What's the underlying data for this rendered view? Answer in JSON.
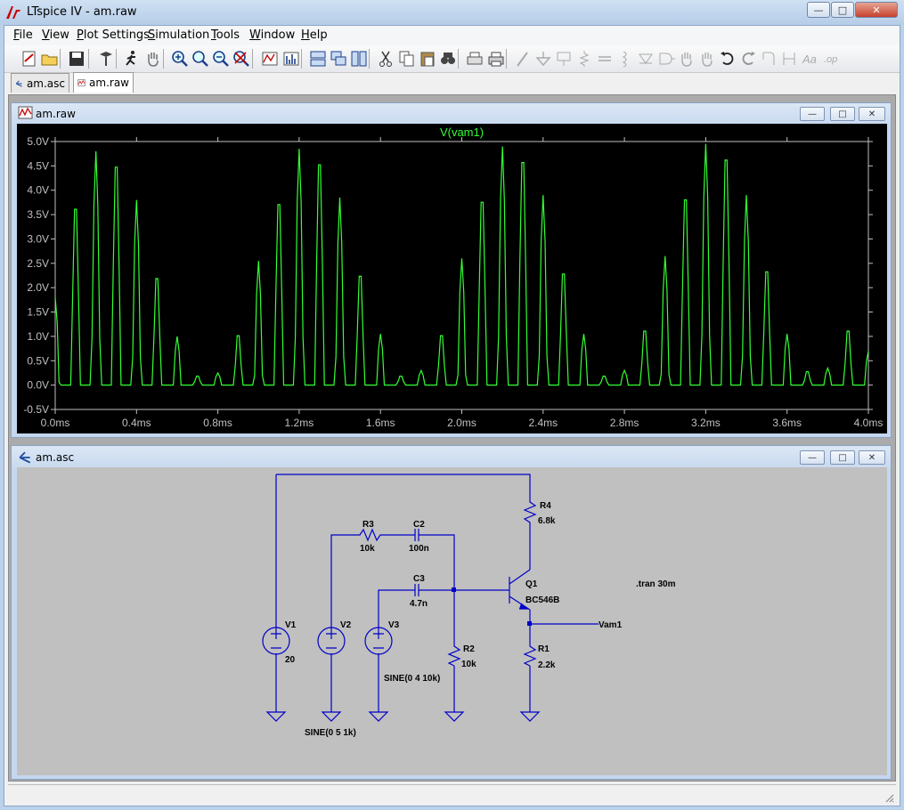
{
  "app": {
    "title": "LTspice IV - am.raw"
  },
  "window_controls": {
    "minimize": "—",
    "maximize": "□",
    "close": "✕"
  },
  "menu": {
    "items": [
      {
        "label": "File",
        "mnemonic": "F",
        "rest": "ile"
      },
      {
        "label": "View",
        "mnemonic": "V",
        "rest": "iew"
      },
      {
        "label": "Plot Settings",
        "mnemonic": "P",
        "rest": "lot Settings"
      },
      {
        "label": "Simulation",
        "mnemonic": "S",
        "rest": "imulation"
      },
      {
        "label": "Tools",
        "mnemonic": "T",
        "rest": "ools"
      },
      {
        "label": "Window",
        "mnemonic": "W",
        "rest": "indow"
      },
      {
        "label": "Help",
        "mnemonic": "H",
        "rest": "elp"
      }
    ]
  },
  "toolbar": {
    "buttons": [
      {
        "name": "new-schematic-icon",
        "enabled": true
      },
      {
        "name": "open-icon",
        "enabled": true
      },
      {
        "name": "save-icon",
        "enabled": true
      },
      {
        "name": "control-panel-icon",
        "enabled": true
      },
      {
        "name": "run-icon",
        "enabled": true
      },
      {
        "name": "pan-hand-icon",
        "enabled": true
      },
      {
        "name": "zoom-in-icon",
        "enabled": true
      },
      {
        "name": "zoom-back-icon",
        "enabled": true
      },
      {
        "name": "zoom-out-icon",
        "enabled": true
      },
      {
        "name": "zoom-fit-icon",
        "enabled": true
      },
      {
        "name": "autorange-icon",
        "enabled": true
      },
      {
        "name": "fft-icon",
        "enabled": true
      },
      {
        "name": "tile-horizontal-icon",
        "enabled": true
      },
      {
        "name": "cascade-icon",
        "enabled": true
      },
      {
        "name": "tile-vertical-icon",
        "enabled": true
      },
      {
        "name": "cut-icon",
        "enabled": true
      },
      {
        "name": "copy-icon",
        "enabled": true
      },
      {
        "name": "paste-icon",
        "enabled": true
      },
      {
        "name": "find-icon",
        "enabled": true
      },
      {
        "name": "print-preview-icon",
        "enabled": true
      },
      {
        "name": "print-icon",
        "enabled": true
      },
      {
        "name": "wire-icon",
        "enabled": false
      },
      {
        "name": "ground-icon",
        "enabled": false
      },
      {
        "name": "label-net-icon",
        "enabled": false
      },
      {
        "name": "resistor-icon",
        "enabled": false
      },
      {
        "name": "capacitor-icon",
        "enabled": false
      },
      {
        "name": "inductor-icon",
        "enabled": false
      },
      {
        "name": "diode-icon",
        "enabled": false
      },
      {
        "name": "component-icon",
        "enabled": false
      },
      {
        "name": "move-icon",
        "enabled": false
      },
      {
        "name": "drag-icon",
        "enabled": false
      },
      {
        "name": "undo-icon",
        "enabled": true
      },
      {
        "name": "redo-icon",
        "enabled": false
      },
      {
        "name": "rotate-icon",
        "enabled": false
      },
      {
        "name": "mirror-icon",
        "enabled": false
      },
      {
        "name": "text-icon",
        "enabled": false
      },
      {
        "name": "spice-directive-icon",
        "enabled": false
      }
    ]
  },
  "tabs": [
    {
      "label": "am.asc",
      "active": false
    },
    {
      "label": "am.raw",
      "active": true
    }
  ],
  "plot_window": {
    "title": "am.raw"
  },
  "schematic_window": {
    "title": "am.asc"
  },
  "chart_data": {
    "type": "line",
    "title": "",
    "series": [
      {
        "name": "V(vam1)",
        "color": "#33ff33"
      }
    ],
    "xlabel": "",
    "ylabel": "",
    "xlim": [
      0.0,
      4.0
    ],
    "ylim": [
      -0.5,
      5.0
    ],
    "x_unit": "ms",
    "y_unit": "V",
    "x_ticks": [
      "0.0ms",
      "0.4ms",
      "0.8ms",
      "1.2ms",
      "1.6ms",
      "2.0ms",
      "2.4ms",
      "2.8ms",
      "3.2ms",
      "3.6ms",
      "4.0ms"
    ],
    "y_ticks": [
      "-0.5V",
      "0.0V",
      "0.5V",
      "1.0V",
      "1.5V",
      "2.0V",
      "2.5V",
      "3.0V",
      "3.5V",
      "4.0V",
      "4.5V",
      "5.0V"
    ],
    "peaks": {
      "x": [
        0.0,
        0.1,
        0.2,
        0.3,
        0.4,
        0.5,
        0.6,
        0.7,
        0.8,
        0.9,
        1.0,
        1.1,
        1.2,
        1.3,
        1.4,
        1.5,
        1.6,
        1.7,
        1.8,
        1.9,
        2.0,
        2.1,
        2.2,
        2.3,
        2.4,
        2.5,
        2.6,
        2.7,
        2.8,
        2.9,
        3.0,
        3.1,
        3.2,
        3.3,
        3.4,
        3.5,
        3.6,
        3.7,
        3.8,
        3.9,
        4.0
      ],
      "y": [
        1.8,
        3.85,
        4.8,
        4.75,
        3.8,
        2.35,
        1.0,
        0.2,
        0.25,
        1.1,
        2.55,
        3.95,
        4.85,
        4.8,
        3.85,
        2.4,
        1.05,
        0.2,
        0.3,
        1.1,
        2.6,
        4.0,
        4.9,
        4.85,
        3.9,
        2.45,
        1.05,
        0.2,
        0.3,
        1.2,
        2.65,
        4.05,
        4.95,
        4.9,
        3.9,
        2.5,
        1.05,
        0.3,
        0.35,
        1.2,
        0.7
      ]
    },
    "grid": false,
    "background": "#000000",
    "axis_color": "#c0c0c0"
  },
  "schematic": {
    "components": [
      {
        "ref": "V1",
        "value": "20"
      },
      {
        "ref": "V2",
        "value": "SINE(0 5 1k)"
      },
      {
        "ref": "V3",
        "value": "SINE(0 4 10k)"
      },
      {
        "ref": "R1",
        "value": "2.2k"
      },
      {
        "ref": "R2",
        "value": "10k"
      },
      {
        "ref": "R3",
        "value": "10k"
      },
      {
        "ref": "R4",
        "value": "6.8k"
      },
      {
        "ref": "C2",
        "value": "100n"
      },
      {
        "ref": "C3",
        "value": "4.7n"
      },
      {
        "ref": "Q1",
        "value": "BC546B"
      }
    ],
    "net_label": "Vam1",
    "directive": ".tran 30m"
  }
}
